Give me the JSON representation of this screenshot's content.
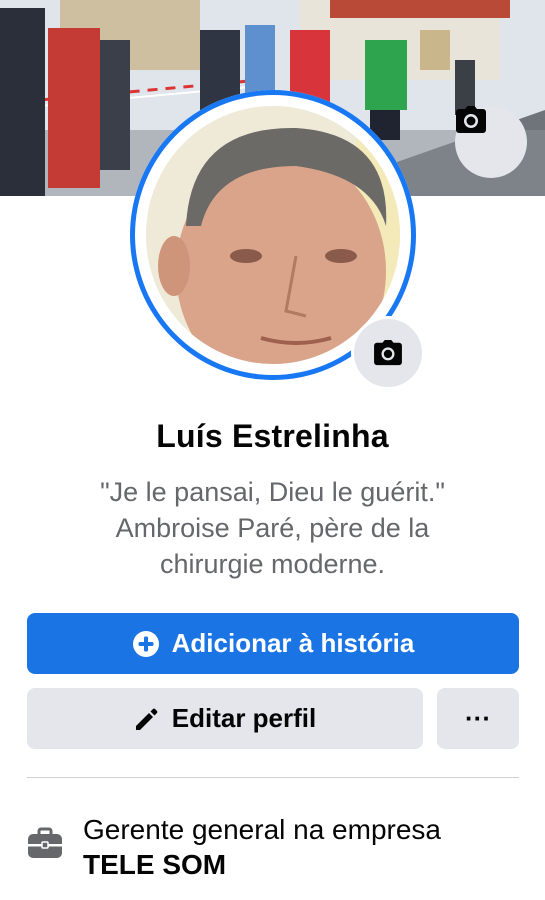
{
  "profile": {
    "name": "Luís Estrelinha",
    "bio_lines": [
      "\"Je le pansai, Dieu le guérit.\"",
      "Ambroise Paré, père de la",
      "chirurgie moderne."
    ]
  },
  "actions": {
    "add_story_label": "Adicionar à história",
    "edit_profile_label": "Editar perfil",
    "more_label": "···"
  },
  "details": {
    "work_prefix": "Gerente general na empresa",
    "work_company": "TELE SOM"
  },
  "colors": {
    "accent": "#1877f2",
    "primary_button": "#1b74e4",
    "secondary_button": "#e4e6eb",
    "muted_text": "#65676b"
  },
  "icons": {
    "cover": "camera-icon",
    "avatar": "camera-icon",
    "add_story": "plus-circle-icon",
    "edit": "pencil-icon",
    "work": "briefcase-icon"
  }
}
